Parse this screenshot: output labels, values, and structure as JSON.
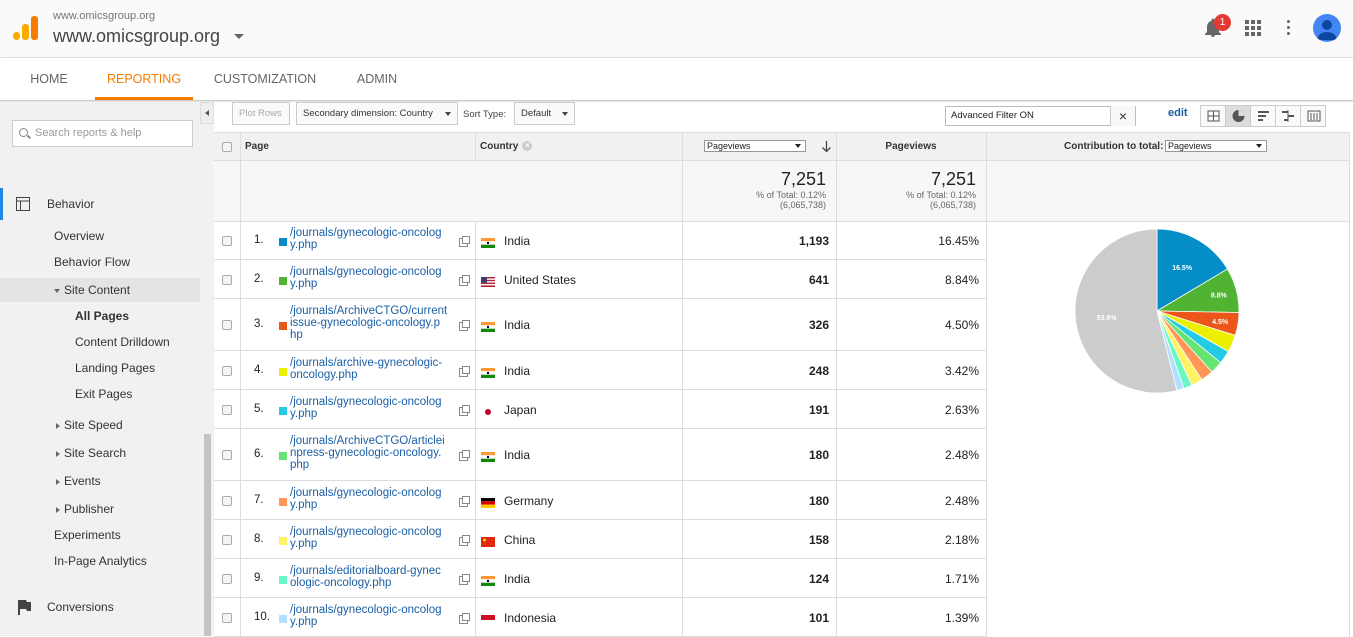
{
  "header": {
    "site_small": "www.omicsgroup.org",
    "site_big": "www.omicsgroup.org",
    "notification_count": "1"
  },
  "nav": {
    "tabs": [
      "HOME",
      "REPORTING",
      "CUSTOMIZATION",
      "ADMIN"
    ],
    "active": "REPORTING"
  },
  "sidebar": {
    "search_placeholder": "Search reports & help",
    "behavior": "Behavior",
    "overview": "Overview",
    "behavior_flow": "Behavior Flow",
    "site_content": "Site Content",
    "all_pages": "All Pages",
    "content_drilldown": "Content Drilldown",
    "landing_pages": "Landing Pages",
    "exit_pages": "Exit Pages",
    "site_speed": "Site Speed",
    "site_search": "Site Search",
    "events": "Events",
    "publisher": "Publisher",
    "experiments": "Experiments",
    "in_page_analytics": "In-Page Analytics",
    "conversions": "Conversions"
  },
  "toolbar": {
    "plot_rows": "Plot Rows",
    "secondary_dimension": "Secondary dimension: Country",
    "sort_type_label": "Sort Type:",
    "sort_type_value": "Default",
    "filter_value": "Advanced Filter ON",
    "edit": "edit"
  },
  "table": {
    "col_page": "Page",
    "col_country": "Country",
    "col_metric_select": "Pageviews",
    "col_pageviews": "Pageviews",
    "col_contribution": "Contribution to total:",
    "col_contribution_select": "Pageviews",
    "total_value": "7,251",
    "total_pct": "% of Total: 0.12%",
    "total_base": "(6,065,738)",
    "total_value2": "7,251",
    "total_pct2": "% of Total: 0.12%",
    "total_base2": "(6,065,738)",
    "rows": [
      {
        "num": "1.",
        "page1": "/journals/gynecologic-oncolog",
        "page2": "y.php",
        "page3": "",
        "country": "India",
        "flag": "india",
        "color": "#058dc7",
        "pageviews": "1,193",
        "pct": "16.45%"
      },
      {
        "num": "2.",
        "page1": "/journals/gynecologic-oncolog",
        "page2": "y.php",
        "page3": "",
        "country": "United States",
        "flag": "us",
        "color": "#50b432",
        "pageviews": "641",
        "pct": "8.84%"
      },
      {
        "num": "3.",
        "page1": "/journals/ArchiveCTGO/current",
        "page2": "issue-gynecologic-oncology.p",
        "page3": "hp",
        "country": "India",
        "flag": "india",
        "color": "#ed561b",
        "pageviews": "326",
        "pct": "4.50%"
      },
      {
        "num": "4.",
        "page1": "/journals/archive-gynecologic-",
        "page2": "oncology.php",
        "page3": "",
        "country": "India",
        "flag": "india",
        "color": "#edef00",
        "pageviews": "248",
        "pct": "3.42%"
      },
      {
        "num": "5.",
        "page1": "/journals/gynecologic-oncolog",
        "page2": "y.php",
        "page3": "",
        "country": "Japan",
        "flag": "japan",
        "color": "#24cbe5",
        "pageviews": "191",
        "pct": "2.63%"
      },
      {
        "num": "6.",
        "page1": "/journals/ArchiveCTGO/articlei",
        "page2": "npress-gynecologic-oncology.",
        "page3": "php",
        "country": "India",
        "flag": "india",
        "color": "#64e572",
        "pageviews": "180",
        "pct": "2.48%"
      },
      {
        "num": "7.",
        "page1": "/journals/gynecologic-oncolog",
        "page2": "y.php",
        "page3": "",
        "country": "Germany",
        "flag": "germany",
        "color": "#ff9655",
        "pageviews": "180",
        "pct": "2.48%"
      },
      {
        "num": "8.",
        "page1": "/journals/gynecologic-oncolog",
        "page2": "y.php",
        "page3": "",
        "country": "China",
        "flag": "china",
        "color": "#fff263",
        "pageviews": "158",
        "pct": "2.18%"
      },
      {
        "num": "9.",
        "page1": "/journals/editorialboard-gynec",
        "page2": "ologic-oncology.php",
        "page3": "",
        "country": "India",
        "flag": "india",
        "color": "#6af9c4",
        "pageviews": "124",
        "pct": "1.71%"
      },
      {
        "num": "10.",
        "page1": "/journals/gynecologic-oncolog",
        "page2": "y.php",
        "page3": "",
        "country": "Indonesia",
        "flag": "indonesia",
        "color": "#b2deff",
        "pageviews": "101",
        "pct": "1.39%"
      }
    ]
  },
  "chart_data": {
    "type": "pie",
    "title": "",
    "slices": [
      {
        "value": 16.45,
        "color": "#058dc7",
        "label": "16.5%"
      },
      {
        "value": 8.84,
        "color": "#50b432",
        "label": "8.8%"
      },
      {
        "value": 4.5,
        "color": "#ed561b",
        "label": "4.5%"
      },
      {
        "value": 3.42,
        "color": "#edef00",
        "label": ""
      },
      {
        "value": 2.63,
        "color": "#24cbe5",
        "label": ""
      },
      {
        "value": 2.48,
        "color": "#64e572",
        "label": ""
      },
      {
        "value": 2.48,
        "color": "#ff9655",
        "label": ""
      },
      {
        "value": 2.18,
        "color": "#fff263",
        "label": ""
      },
      {
        "value": 1.71,
        "color": "#6af9c4",
        "label": ""
      },
      {
        "value": 1.39,
        "color": "#b2deff",
        "label": ""
      },
      {
        "value": 53.9,
        "color": "#cccccc",
        "label": "53.9%"
      }
    ]
  }
}
